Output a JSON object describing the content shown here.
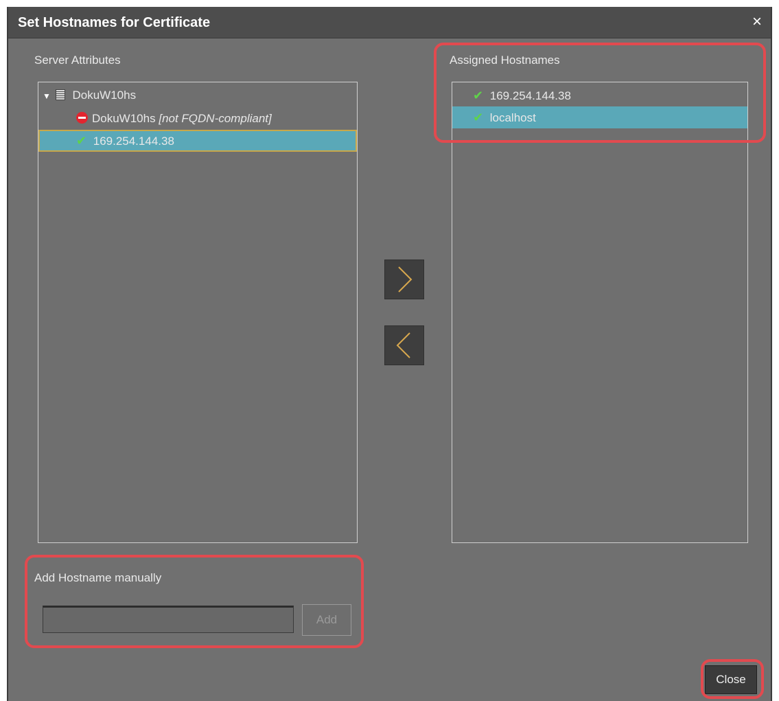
{
  "dialog": {
    "title": "Set Hostnames for Certificate",
    "close_glyph": "×"
  },
  "server_attributes": {
    "label": "Server Attributes",
    "root": {
      "name": "DokuW10hs",
      "icon": "server-icon",
      "expanded": true
    },
    "items": [
      {
        "name": "DokuW10hs",
        "note": "[not FQDN-compliant]",
        "status": "invalid",
        "icon": "stop-icon"
      },
      {
        "name": "169.254.144.38",
        "status": "valid",
        "icon": "check-icon",
        "selected": true
      }
    ]
  },
  "assigned_hostnames": {
    "label": "Assigned Hostnames",
    "items": [
      {
        "name": "169.254.144.38",
        "icon": "check-icon",
        "selected": false
      },
      {
        "name": "localhost",
        "icon": "check-icon",
        "selected": true
      }
    ]
  },
  "transfer": {
    "add_icon": "chevron-right-icon",
    "remove_icon": "chevron-left-icon"
  },
  "manual": {
    "label": "Add Hostname manually",
    "value": "",
    "placeholder": "",
    "add_label": "Add"
  },
  "footer": {
    "close_label": "Close"
  },
  "colors": {
    "dialog_bg": "#707070",
    "titlebar_bg": "#4d4d4d",
    "selection": "#5aa8b8",
    "focus_border": "#c8a84a",
    "check": "#5fd34a",
    "error": "#e2252f",
    "callout": "#e24a4f",
    "chevron": "#d8a84e"
  }
}
